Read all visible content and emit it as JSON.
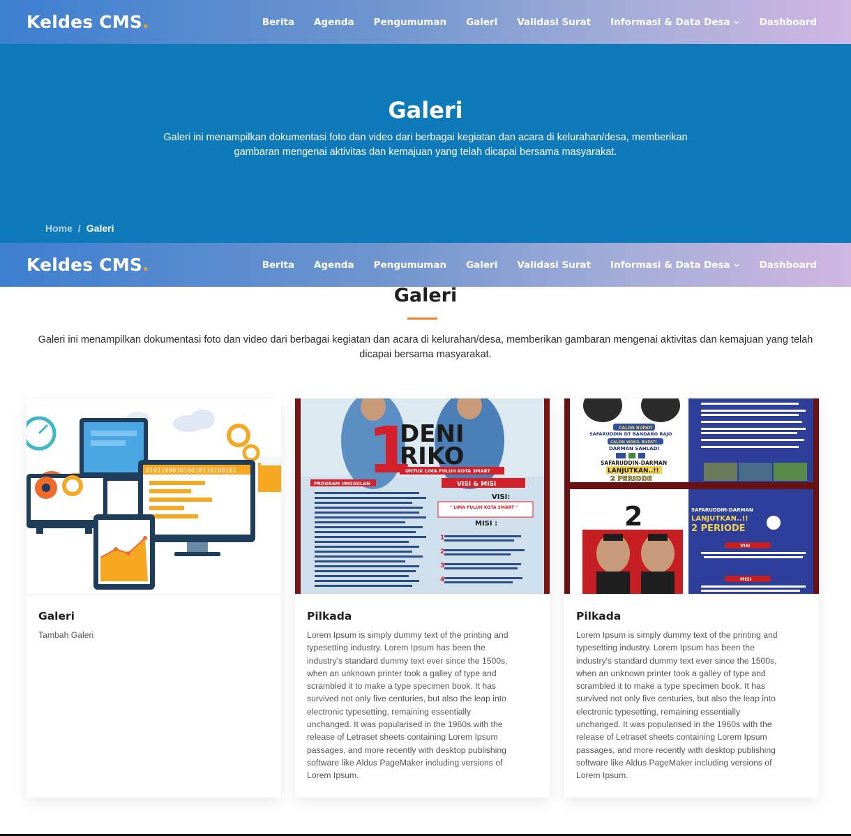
{
  "brand": {
    "name": "Keldes CMS",
    "dot": ".",
    "accent": "#f4a21e"
  },
  "nav": {
    "items": [
      {
        "label": "Berita"
      },
      {
        "label": "Agenda"
      },
      {
        "label": "Pengumuman"
      },
      {
        "label": "Galeri"
      },
      {
        "label": "Validasi Surat"
      },
      {
        "label": "Informasi & Data Desa",
        "dropdown": true,
        "icon": "chevron-down-icon"
      },
      {
        "label": "Dashboard"
      }
    ]
  },
  "hero": {
    "title": "Galeri",
    "description": "Galeri ini menampilkan dokumentasi foto dan video dari berbagai kegiatan dan acara di kelurahan/desa, memberikan gambaran mengenai aktivitas dan kemajuan yang telah dicapai bersama masyarakat.",
    "background": "#0f7ab9"
  },
  "breadcrumb": {
    "home": "Home",
    "separator": "/",
    "current": "Galeri"
  },
  "section": {
    "title": "Galeri",
    "description": "Galeri ini menampilkan dokumentasi foto dan video dari berbagai kegiatan dan acara di kelurahan/desa, memberikan gambaran mengenai aktivitas dan kemajuan yang telah dicapai bersama masyarakat."
  },
  "cards": [
    {
      "title": "Galeri",
      "text": "Tambah Galeri",
      "image": "tech-illustration"
    },
    {
      "title": "Pilkada",
      "text": "Lorem Ipsum is simply dummy text of the printing and typesetting industry. Lorem Ipsum has been the industry's standard dummy text ever since the 1500s, when an unknown printer took a galley of type and scrambled it to make a type specimen book. It has survived not only five centuries, but also the leap into electronic typesetting, remaining essentially unchanged. It was popularised in the 1960s with the release of Letraset sheets containing Lorem Ipsum passages, and more recently with desktop publishing software like Aldus PageMaker including versions of Lorem Ipsum.",
      "image": "campaign-poster-1"
    },
    {
      "title": "Pilkada",
      "text": "Lorem Ipsum is simply dummy text of the printing and typesetting industry. Lorem Ipsum has been the industry's standard dummy text ever since the 1500s, when an unknown printer took a galley of type and scrambled it to make a type specimen book. It has survived not only five centuries, but also the leap into electronic typesetting, remaining essentially unchanged. It was popularised in the 1960s with the release of Letraset sheets containing Lorem Ipsum passages, and more recently with desktop publishing software like Aldus PageMaker including versions of Lorem Ipsum.",
      "image": "campaign-poster-2"
    }
  ],
  "posters": {
    "one": {
      "number": "1",
      "names": [
        "DENI",
        "RIKO"
      ],
      "tagline": "UNTUK LIMA PULUH KOTA SMART",
      "program_heading": "PROGRAM UNGGULAN",
      "visi_misi_heading": "VISI & MISI",
      "visi_label": "VISI:",
      "visi_text": "\" LIMA PULUH KOTA SMART \"",
      "misi_label": "MISI :"
    },
    "two": {
      "number": "2",
      "calon_bupati_label": "CALON BUPATI",
      "bupati_name": "SAFARUDDIN DT BANDARO RAJO",
      "calon_wakil_label": "CALON WAKIL BUPATI",
      "wakil_name": "DARMAN SAHLADI",
      "slogan_names": "SAFARUDDIN-DARMAN",
      "slogan_main": "LANJUTKAN..!!",
      "slogan_period": "2 PERIODE",
      "visi_label": "VISI",
      "misi_label": "MISI"
    }
  },
  "colors": {
    "navbar_start": "#3d7fd0",
    "navbar_end": "#d1b6e2",
    "title_underline": "#e9852d"
  }
}
